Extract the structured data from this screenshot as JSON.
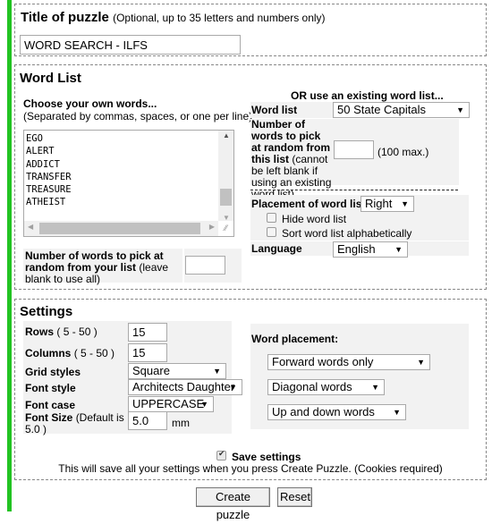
{
  "title_section": {
    "heading": "Title of puzzle",
    "hint": "(Optional, up to 35 letters and numbers only)",
    "value": "WORD SEARCH - ILFS"
  },
  "word_list": {
    "heading": "Word List",
    "own": {
      "label": "Choose your own words...",
      "hint": "(Separated by commas, spaces, or one per line)",
      "words": [
        "EGO",
        "ALERT",
        "ADDICT",
        "TRANSFER",
        "TREASURE",
        "ATHEIST"
      ],
      "pick_label_bold": "Number of words to pick at random from your list",
      "pick_label_hint": "(leave blank to use all)",
      "pick_value": ""
    },
    "existing": {
      "label": "OR use an existing word list...",
      "list_label": "Word list",
      "list_value": "50 State Capitals",
      "count_label_bold": "Number of words to pick at random from this list",
      "count_label_hint": "(cannot be left blank if using an existing word list)",
      "count_value": "",
      "count_max": "(100 max.)"
    },
    "placement_label": "Placement of word list:",
    "placement_value": "Right",
    "hide_label": "Hide word list",
    "hide_checked": false,
    "sort_label": "Sort word list alphabetically",
    "sort_checked": false,
    "language_label": "Language",
    "language_value": "English"
  },
  "settings": {
    "heading": "Settings",
    "rows_label": "Rows",
    "rows_range": "( 5 - 50 )",
    "rows_value": "15",
    "columns_label": "Columns",
    "columns_range": "( 5 - 50 )",
    "columns_value": "15",
    "grid_label": "Grid styles",
    "grid_value": "Square",
    "font_style_label": "Font style",
    "font_style_value": "Architects Daughter",
    "font_case_label": "Font case",
    "font_case_value": "UPPERCASE",
    "font_size_label": "Font Size",
    "font_size_hint": "(Default is 5.0 )",
    "font_size_value": "5.0",
    "font_size_unit": "mm",
    "word_placement_label": "Word placement:",
    "direction_value": "Forward words only",
    "diagonal_value": "Diagonal words",
    "updown_value": "Up and down words",
    "save_label": "Save settings",
    "save_checked": true,
    "save_note": "This will save all your settings when you press Create Puzzle. (Cookies required)"
  },
  "actions": {
    "create_label": "Create puzzle",
    "reset_label": "Reset"
  },
  "icons": {
    "dropdown": "▼",
    "scroll_up": "▲",
    "scroll_down": "▼",
    "scroll_left": "◀",
    "scroll_right": "▶",
    "resize": "⁄⁄"
  },
  "colors": {
    "accent_bar": "#22c322",
    "panel_gray": "#f2f2f2"
  }
}
